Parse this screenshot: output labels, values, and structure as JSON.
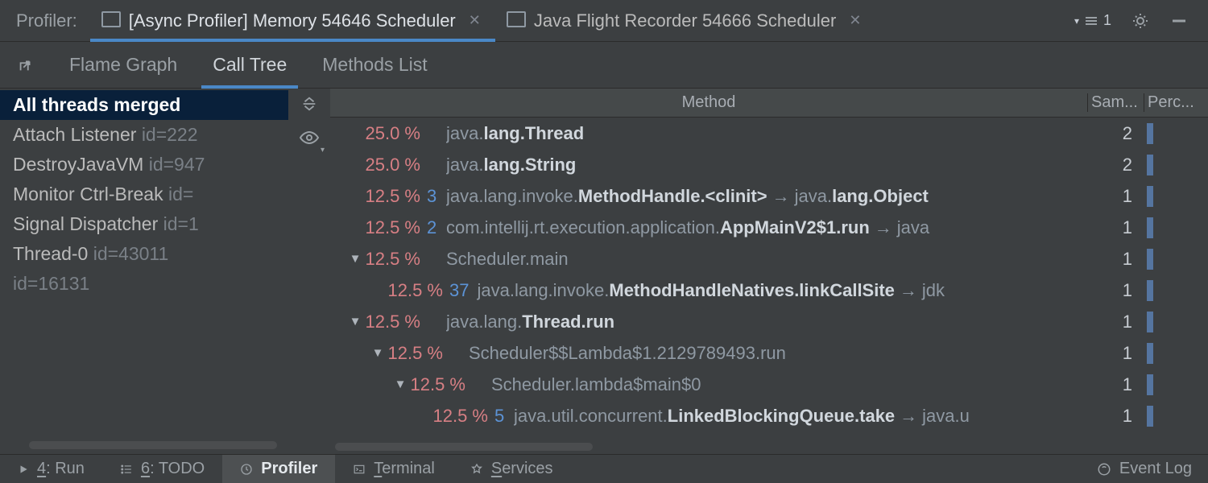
{
  "header": {
    "title": "Profiler:",
    "tabs": [
      {
        "label": "[Async Profiler] Memory 54646 Scheduler",
        "active": true
      },
      {
        "label": "Java Flight Recorder 54666 Scheduler",
        "active": false
      }
    ],
    "badge": "1"
  },
  "viewTabs": {
    "items": [
      "Flame Graph",
      "Call Tree",
      "Methods List"
    ],
    "activeIndex": 1
  },
  "threads": {
    "items": [
      {
        "name": "All threads merged",
        "id": "",
        "selected": true
      },
      {
        "name": "Attach Listener",
        "id": "id=222"
      },
      {
        "name": "DestroyJavaVM",
        "id": "id=947"
      },
      {
        "name": "Monitor Ctrl-Break",
        "id": "id="
      },
      {
        "name": "Signal Dispatcher",
        "id": "id=1"
      },
      {
        "name": "Thread-0",
        "id": "id=43011"
      },
      {
        "name": "",
        "id": "id=16131"
      }
    ]
  },
  "tree": {
    "columns": {
      "method": "Method",
      "samples": "Sam...",
      "percent": "Perc..."
    },
    "rows": [
      {
        "indent": 0,
        "arrow": "",
        "pct": "25.0 %",
        "num": "",
        "parts": [
          [
            "grey",
            "java."
          ],
          [
            "bold",
            "lang.Thread"
          ]
        ],
        "sam": "2"
      },
      {
        "indent": 0,
        "arrow": "",
        "pct": "25.0 %",
        "num": "",
        "parts": [
          [
            "grey",
            "java."
          ],
          [
            "bold",
            "lang.String"
          ]
        ],
        "sam": "2"
      },
      {
        "indent": 0,
        "arrow": "",
        "pct": "12.5 %",
        "num": "3",
        "parts": [
          [
            "grey",
            "java.lang.invoke."
          ],
          [
            "bold",
            "MethodHandle.<clinit>"
          ],
          [
            "arrow",
            "→"
          ],
          [
            "grey",
            "java."
          ],
          [
            "bold",
            "lang.Object"
          ]
        ],
        "sam": "1"
      },
      {
        "indent": 0,
        "arrow": "",
        "pct": "12.5 %",
        "num": "2",
        "parts": [
          [
            "grey",
            "com.intellij.rt.execution.application."
          ],
          [
            "bold",
            "AppMainV2$1.run"
          ],
          [
            "arrow",
            "→"
          ],
          [
            "grey",
            "java"
          ]
        ],
        "sam": "1"
      },
      {
        "indent": 0,
        "arrow": "▼",
        "pct": "12.5 %",
        "num": "",
        "parts": [
          [
            "grey",
            "Scheduler.main"
          ]
        ],
        "sam": "1"
      },
      {
        "indent": 1,
        "arrow": "",
        "pct": "12.5 %",
        "num": "37",
        "parts": [
          [
            "grey",
            "java.lang.invoke."
          ],
          [
            "bold",
            "MethodHandleNatives.linkCallSite"
          ],
          [
            "arrow",
            "→"
          ],
          [
            "grey",
            "jdk"
          ]
        ],
        "sam": "1"
      },
      {
        "indent": 0,
        "arrow": "▼",
        "pct": "12.5 %",
        "num": "",
        "parts": [
          [
            "grey",
            "java.lang."
          ],
          [
            "bold",
            "Thread.run"
          ]
        ],
        "sam": "1"
      },
      {
        "indent": 1,
        "arrow": "▼",
        "pct": "12.5 %",
        "num": "",
        "parts": [
          [
            "grey",
            "Scheduler$$Lambda$1.2129789493.run"
          ]
        ],
        "sam": "1"
      },
      {
        "indent": 2,
        "arrow": "▼",
        "pct": "12.5 %",
        "num": "",
        "parts": [
          [
            "grey",
            "Scheduler.lambda$main$0"
          ]
        ],
        "sam": "1"
      },
      {
        "indent": 3,
        "arrow": "",
        "pct": "12.5 %",
        "num": "5",
        "parts": [
          [
            "grey",
            "java.util.concurrent."
          ],
          [
            "bold",
            "LinkedBlockingQueue.take"
          ],
          [
            "arrow",
            "→"
          ],
          [
            "grey",
            "java.u"
          ]
        ],
        "sam": "1"
      }
    ]
  },
  "status": {
    "left": [
      {
        "icon": "play",
        "label": "4: Run"
      },
      {
        "icon": "list",
        "label": "6: TODO"
      },
      {
        "icon": "clock",
        "label": "Profiler",
        "active": true
      },
      {
        "icon": "terminal",
        "label": "Terminal"
      },
      {
        "icon": "services",
        "label": "Services"
      }
    ],
    "right": "Event Log"
  }
}
